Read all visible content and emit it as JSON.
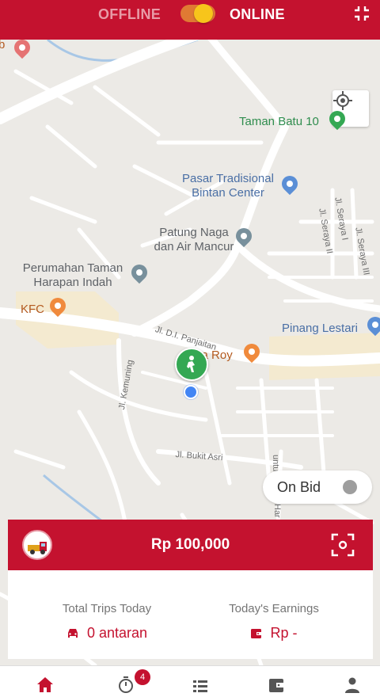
{
  "header": {
    "offline_label": "OFFLINE",
    "online_label": "ONLINE",
    "is_online": true
  },
  "map": {
    "places": {
      "taman_batu": "Taman Batu 10",
      "pasar_line1": "Pasar Tradisional",
      "pasar_line2": "Bintan Center",
      "patung_line1": "Patung Naga",
      "patung_line2": "dan Air Mancur",
      "perumahan_line1": "Perumahan Taman",
      "perumahan_line2": "Harapan Indah",
      "kfc": "KFC",
      "pinang": "Pinang Lestari",
      "kata_roy": "Kata Roy"
    },
    "streets": {
      "dr_panjaitan": "Jl. D.I. Panjaitan",
      "kemuning": "Jl. Kemuning",
      "bukit_asri": "Jl. Bukit Asri",
      "seraya_1": "Jl. Seraya I",
      "seraya_2": "Jl. Seraya II",
      "seraya_3": "Jl. Seraya III",
      "untu": "untu",
      "har": "Har"
    },
    "partial_label": "b"
  },
  "bid_toggle": {
    "label": "On Bid",
    "enabled": false
  },
  "balance": {
    "text": "Rp 100,000"
  },
  "stats": {
    "trips_title": "Total Trips Today",
    "trips_value": "0 antaran",
    "earnings_title": "Today's Earnings",
    "earnings_value": "Rp -"
  },
  "bottom_nav": {
    "items": [
      "home-icon",
      "timer-icon",
      "list-icon",
      "wallet-icon",
      "profile-icon"
    ],
    "active": "home-icon",
    "timer_badge": "4"
  },
  "colors": {
    "brand": "#c4122f",
    "toggle_on": "#f7c51b",
    "map_bg": "#eceae6"
  }
}
